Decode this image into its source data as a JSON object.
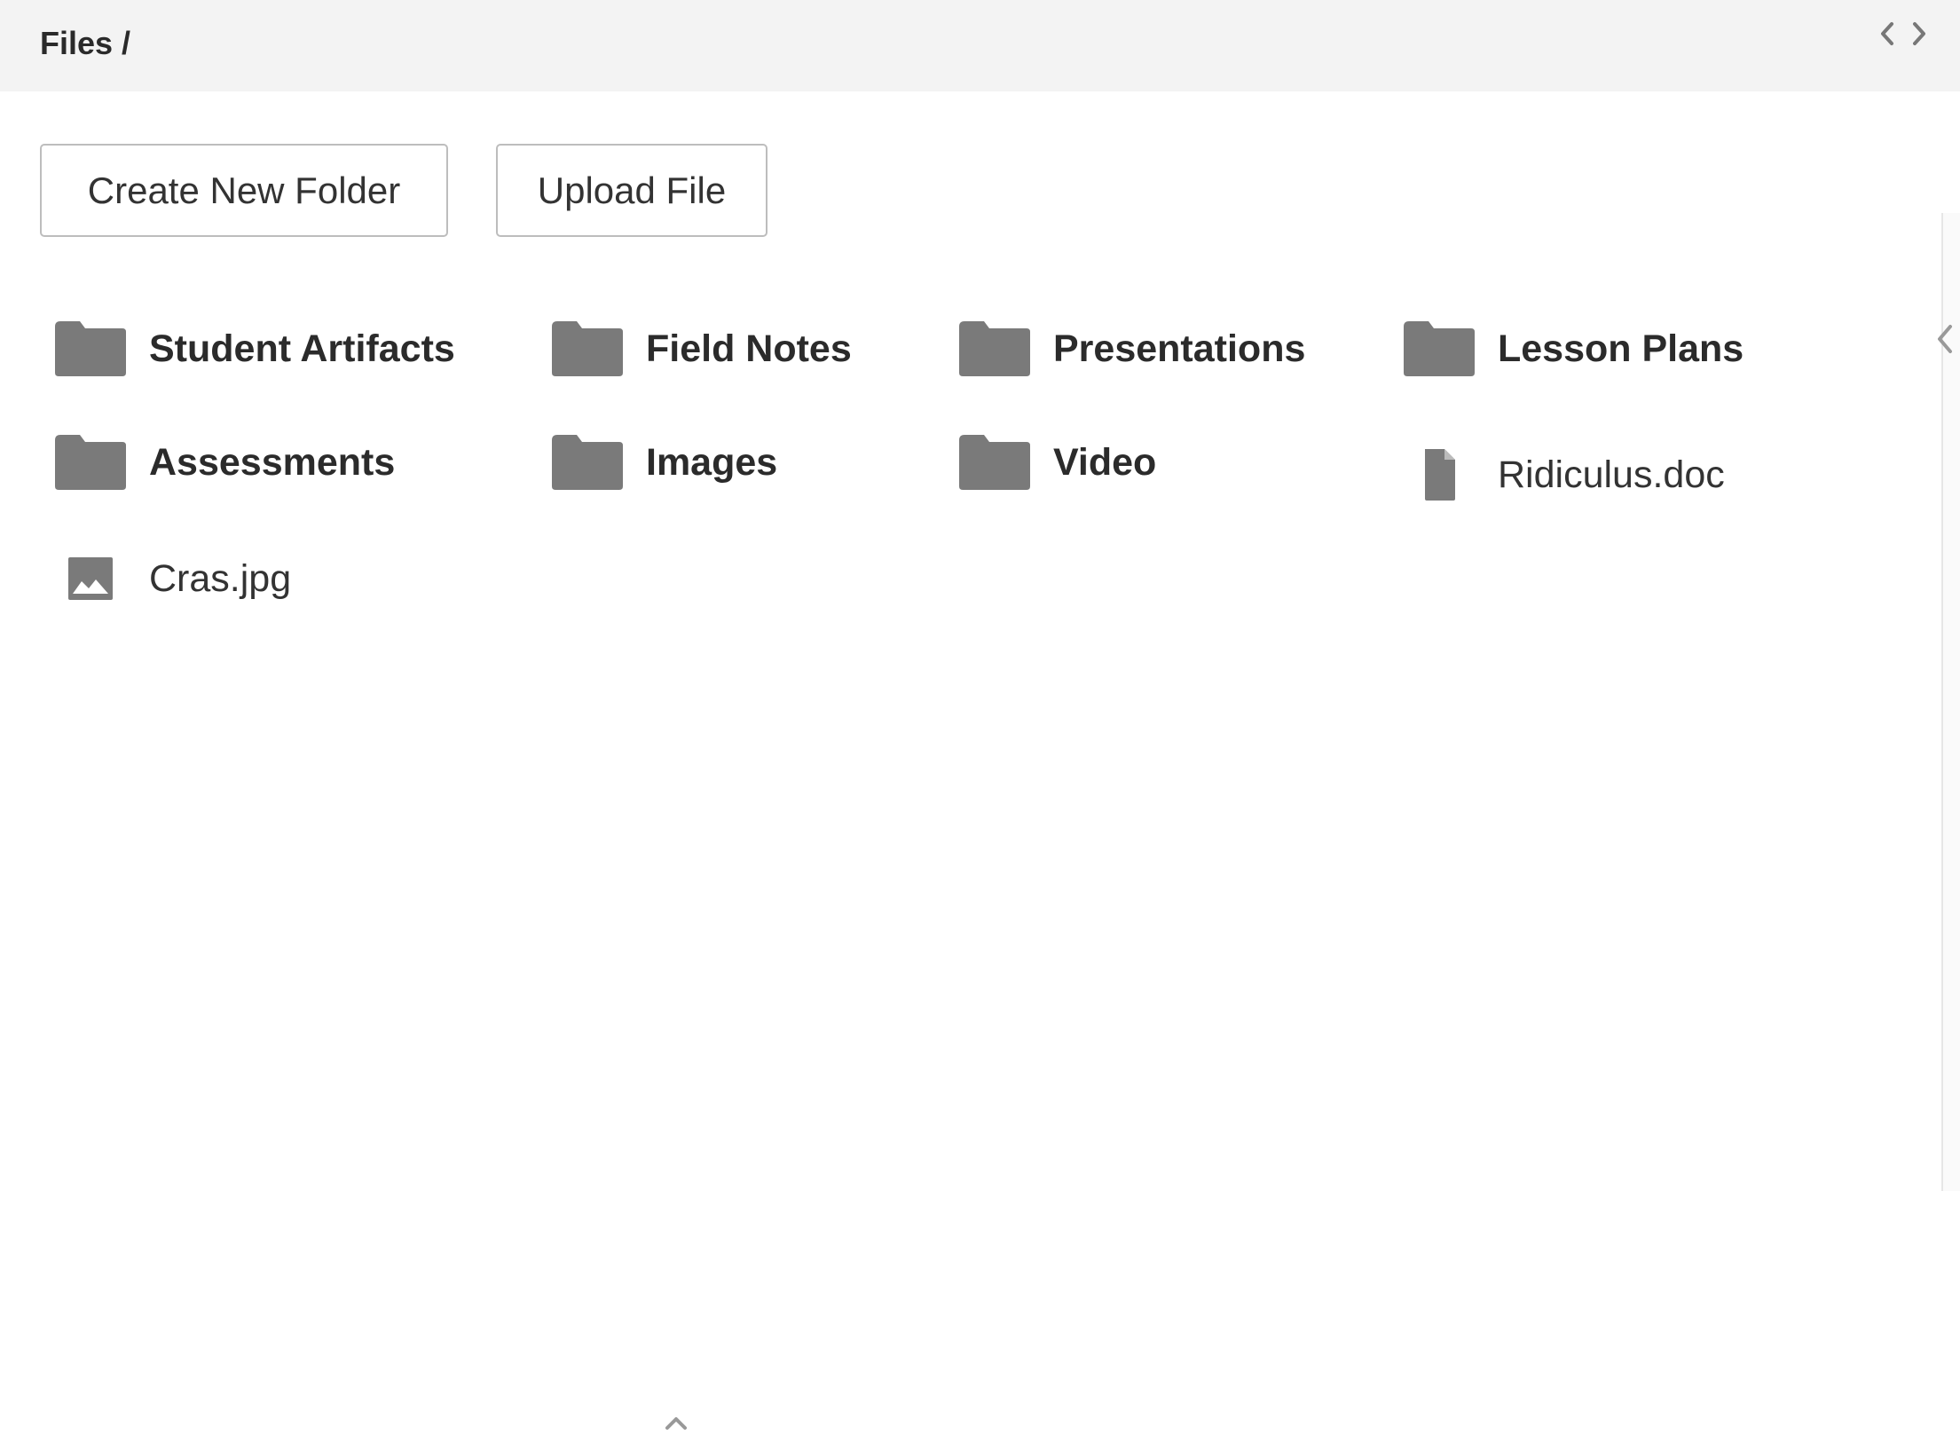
{
  "header": {
    "breadcrumb": "Files /",
    "code_toggle_icon": "code-icon"
  },
  "toolbar": {
    "create_folder_label": "Create New Folder",
    "upload_file_label": "Upload File"
  },
  "items": [
    {
      "type": "folder",
      "name": "Student Artifacts",
      "icon": "folder-icon"
    },
    {
      "type": "folder",
      "name": "Field Notes",
      "icon": "folder-icon"
    },
    {
      "type": "folder",
      "name": "Presentations",
      "icon": "folder-icon"
    },
    {
      "type": "folder",
      "name": "Lesson Plans",
      "icon": "folder-icon"
    },
    {
      "type": "folder",
      "name": "Assessments",
      "icon": "folder-icon"
    },
    {
      "type": "folder",
      "name": "Images",
      "icon": "folder-icon"
    },
    {
      "type": "folder",
      "name": "Video",
      "icon": "folder-icon"
    },
    {
      "type": "file",
      "name": "Ridiculus.doc",
      "icon": "document-icon"
    },
    {
      "type": "file",
      "name": "Cras.jpg",
      "icon": "image-icon"
    }
  ],
  "colors": {
    "icon_gray": "#7a7a7a",
    "header_bg": "#f3f3f3",
    "border": "#bdbdbd"
  }
}
